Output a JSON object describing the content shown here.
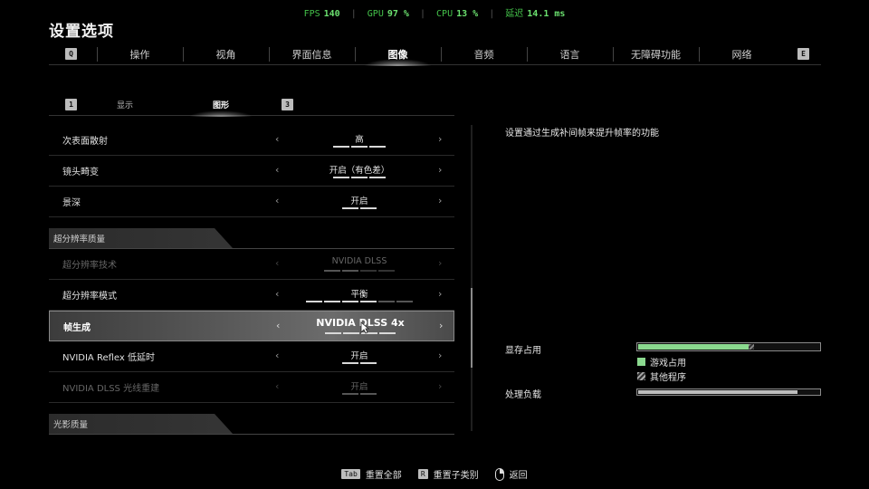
{
  "perf": {
    "fps_label": "FPS",
    "fps": "140",
    "gpu_label": "GPU",
    "gpu": "97 %",
    "cpu_label": "CPU",
    "cpu": "13 %",
    "latency_label": "延迟",
    "latency": "14.1 ms"
  },
  "page_title": "设置选项",
  "top_tabs": {
    "left_key": "Q",
    "right_key": "E",
    "items": [
      "操作",
      "视角",
      "界面信息",
      "图像",
      "音频",
      "语言",
      "无障碍功能",
      "网络"
    ],
    "active_index": 3
  },
  "sub_tabs": {
    "left_key": "1",
    "right_key": "3",
    "items": [
      "显示",
      "图形"
    ],
    "active_index": 1
  },
  "settings": {
    "row0": {
      "label": "次表面散射",
      "value": "高",
      "segments": 3,
      "level": 3
    },
    "row1": {
      "label": "镜头畸变",
      "value": "开启（有色差）",
      "segments": 3,
      "level": 3
    },
    "row2": {
      "label": "景深",
      "value": "开启",
      "segments": 2,
      "level": 2
    },
    "section1": "超分辨率质量",
    "row3": {
      "label": "超分辨率技术",
      "value": "NVIDIA DLSS",
      "segments": 4,
      "level": 2,
      "disabled": true
    },
    "row4": {
      "label": "超分辨率模式",
      "value": "平衡",
      "segments": 6,
      "level": 4
    },
    "row5": {
      "label": "帧生成",
      "value": "NVIDIA DLSS 4x",
      "segments": 4,
      "level": 4,
      "selected": true
    },
    "row6": {
      "label": "NVIDIA Reflex 低延时",
      "value": "开启",
      "segments": 2,
      "level": 2
    },
    "row7": {
      "label": "NVIDIA DLSS 光线重建",
      "value": "开启",
      "segments": 2,
      "level": 2,
      "disabled": true
    },
    "section2": "光影质量"
  },
  "arrows": {
    "left": "‹",
    "right": "›"
  },
  "description": "设置通过生成补间帧来提升帧率的功能",
  "vram": {
    "label": "显存占用",
    "game_fraction": 0.61,
    "other_fraction": 0.03,
    "legend_game": "游戏占用",
    "legend_other": "其他程序"
  },
  "load": {
    "label": "处理负载",
    "fraction": 0.88
  },
  "footer": {
    "reset_all_key": "Tab",
    "reset_all": "重置全部",
    "reset_sub_key": "R",
    "reset_sub": "重置子类别",
    "back": "返回"
  },
  "colors": {
    "accent_green": "#8bd98f",
    "perf_green": "#44c24a"
  }
}
